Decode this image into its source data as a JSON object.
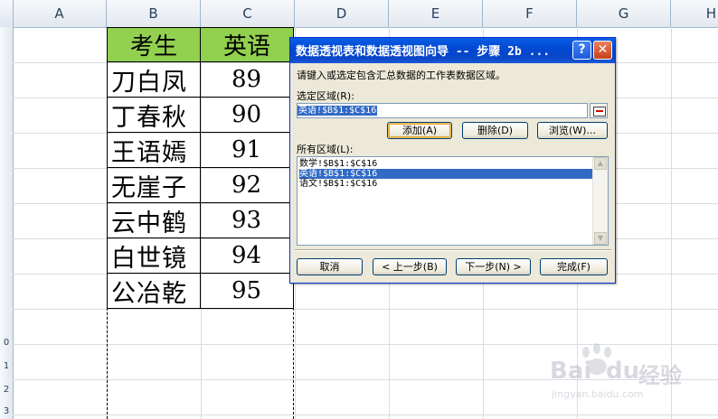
{
  "sheet": {
    "columns": [
      "A",
      "B",
      "C",
      "D",
      "E",
      "F",
      "G",
      "H"
    ],
    "row_numbers": [
      "0",
      "1",
      "2",
      "3"
    ],
    "table": {
      "headers": [
        "考生",
        "英语"
      ],
      "rows": [
        {
          "name": "刀白凤",
          "score": "89"
        },
        {
          "name": "丁春秋",
          "score": "90"
        },
        {
          "name": "王语嫣",
          "score": "91"
        },
        {
          "name": "无崖子",
          "score": "92"
        },
        {
          "name": "云中鹤",
          "score": "93"
        },
        {
          "name": "白世镜",
          "score": "94"
        },
        {
          "name": "公冶乾",
          "score": "95"
        }
      ]
    },
    "header_fill_color": "#92d050"
  },
  "dialog": {
    "title": "数据透视表和数据透视图向导 -- 步骤 2b ...",
    "help_label": "?",
    "close_label": "✕",
    "instruction": "请键入或选定包含汇总数据的工作表数据区域。",
    "range_label": "选定区域(R):",
    "range_value": "英语!$B$1:$C$16",
    "add_label": "添加(A)",
    "delete_label": "删除(D)",
    "browse_label": "浏览(W)...",
    "all_ranges_label": "所有区域(L):",
    "all_ranges": [
      {
        "text": "数学!$B$1:$C$16",
        "selected": false
      },
      {
        "text": "英语!$B$1:$C$16",
        "selected": true
      },
      {
        "text": "语文!$B$1:$C$16",
        "selected": false
      }
    ],
    "cancel_label": "取消",
    "back_label": "< 上一步(B)",
    "next_label": "下一步(N) >",
    "finish_label": "完成(F)",
    "accent_color": "#0a5fe6"
  },
  "watermark": {
    "brand": "Bai",
    "brand2": "du",
    "brand_cn": "经验",
    "url": "jingyan.baidu.com"
  }
}
